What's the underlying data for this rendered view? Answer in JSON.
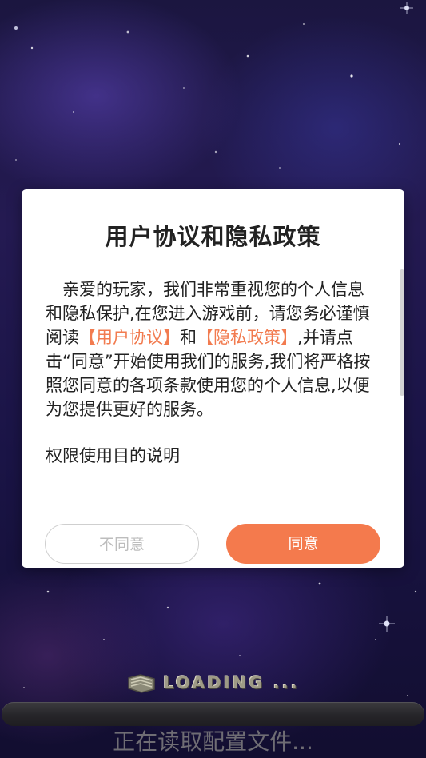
{
  "dialog": {
    "title": "用户协议和隐私政策",
    "body_intro": "亲爱的玩家，我们非常重视您的个人信息和隐私保护,在您进入游戏前，请您务必谨慎阅读",
    "user_agreement_link": "【用户协议】",
    "and_text": "和",
    "privacy_policy_link": "【隐私政策】",
    "body_rest": ",并请点击“同意”开始使用我们的服务,我们将严格按照您同意的各项条款使用您的个人信息,以便为您提供更好的服务。",
    "permissions_heading": "权限使用目的说明",
    "disagree_label": "不同意",
    "agree_label": "同意"
  },
  "loading": {
    "label": "LOADING ...",
    "status": "正在读取配置文件..."
  },
  "colors": {
    "accent": "#f47a4d",
    "link": "#f27b4f",
    "modal_bg": "#ffffff",
    "disabled_text": "#bdbdbd"
  }
}
